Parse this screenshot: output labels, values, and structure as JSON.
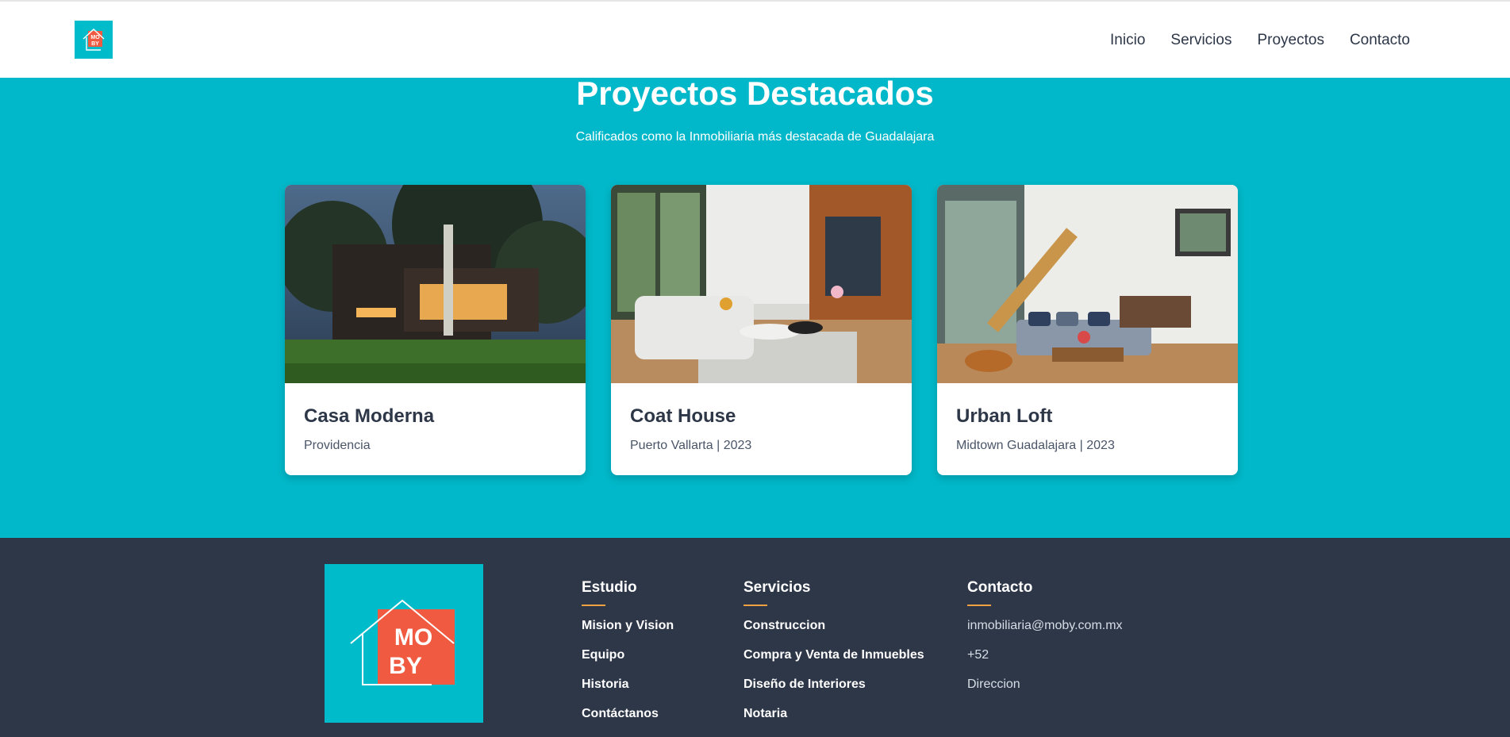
{
  "header": {
    "logo_text": "MO BY",
    "nav": [
      "Inicio",
      "Servicios",
      "Proyectos",
      "Contacto"
    ]
  },
  "section": {
    "title": "Proyectos Destacados",
    "subtitle": "Calificados como la Inmobiliaria más destacada de Guadalajara"
  },
  "projects": [
    {
      "title": "Casa Moderna",
      "meta": "Providencia",
      "image": "modern-house-photo"
    },
    {
      "title": "Coat House",
      "meta": "Puerto Vallarta | 2023",
      "image": "living-room-photo"
    },
    {
      "title": "Urban Loft",
      "meta": "Midtown Guadalajara | 2023",
      "image": "loft-interior-photo"
    }
  ],
  "footer": {
    "logo_text": "MO BY",
    "estudio": {
      "heading": "Estudio",
      "items": [
        "Mision y Vision",
        "Equipo",
        "Historia",
        "Contáctanos"
      ]
    },
    "servicios": {
      "heading": "Servicios",
      "items": [
        "Construccion",
        "Compra y Venta de Inmuebles",
        "Diseño de Interiores",
        "Notaria"
      ]
    },
    "contacto": {
      "heading": "Contacto",
      "items": [
        "inmobiliaria@moby.com.mx",
        "+52",
        "Direccion"
      ]
    }
  },
  "colors": {
    "accent": "#00b8c9",
    "footer_bg": "#2e3748",
    "logo_orange": "#f05a40",
    "underline": "#f0a040"
  }
}
